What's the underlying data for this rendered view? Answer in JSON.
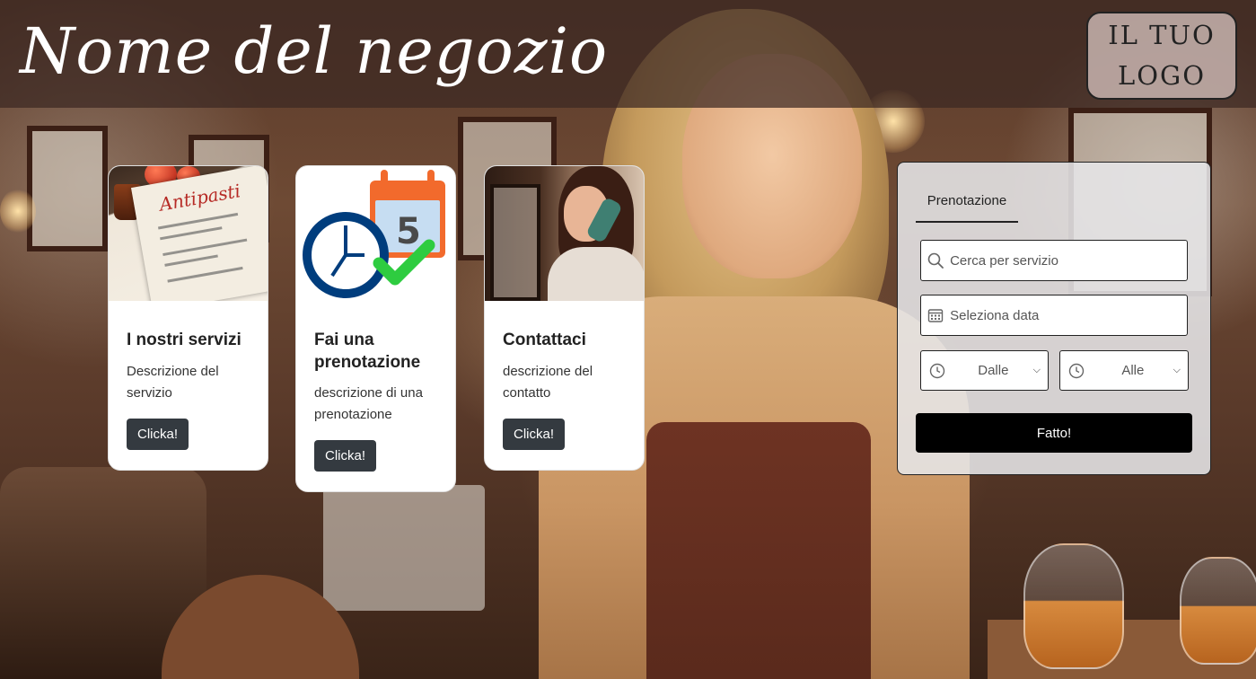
{
  "header": {
    "shop_name": "Nome del negozio",
    "logo_line1": "IL TUO",
    "logo_line2": "LOGO"
  },
  "cards": [
    {
      "title": "I nostri servizi",
      "text": "Descrizione del servizio",
      "button": "Clicka!",
      "image": "restaurant-menu-photo"
    },
    {
      "title": "Fai una prenotazione",
      "text": "descrizione di una prenotazione",
      "button": "Clicka!",
      "image": "calendar-clock-icon",
      "calendar_number": "5"
    },
    {
      "title": "Contattaci",
      "text": "descrizione del contatto",
      "button": "Clicka!",
      "image": "woman-on-phone-photo",
      "menu_word": "Antipasti"
    }
  ],
  "booking": {
    "tab_label": "Prenotazione",
    "search_placeholder": "Cerca per servizio",
    "date_placeholder": "Seleziona data",
    "from_label": "Dalle",
    "to_label": "Alle",
    "submit_label": "Fatto!"
  },
  "colors": {
    "accent_dark": "#343a40",
    "calendar_orange": "#f26a2c",
    "clock_blue": "#003d7d",
    "check_green": "#2ecc40"
  }
}
